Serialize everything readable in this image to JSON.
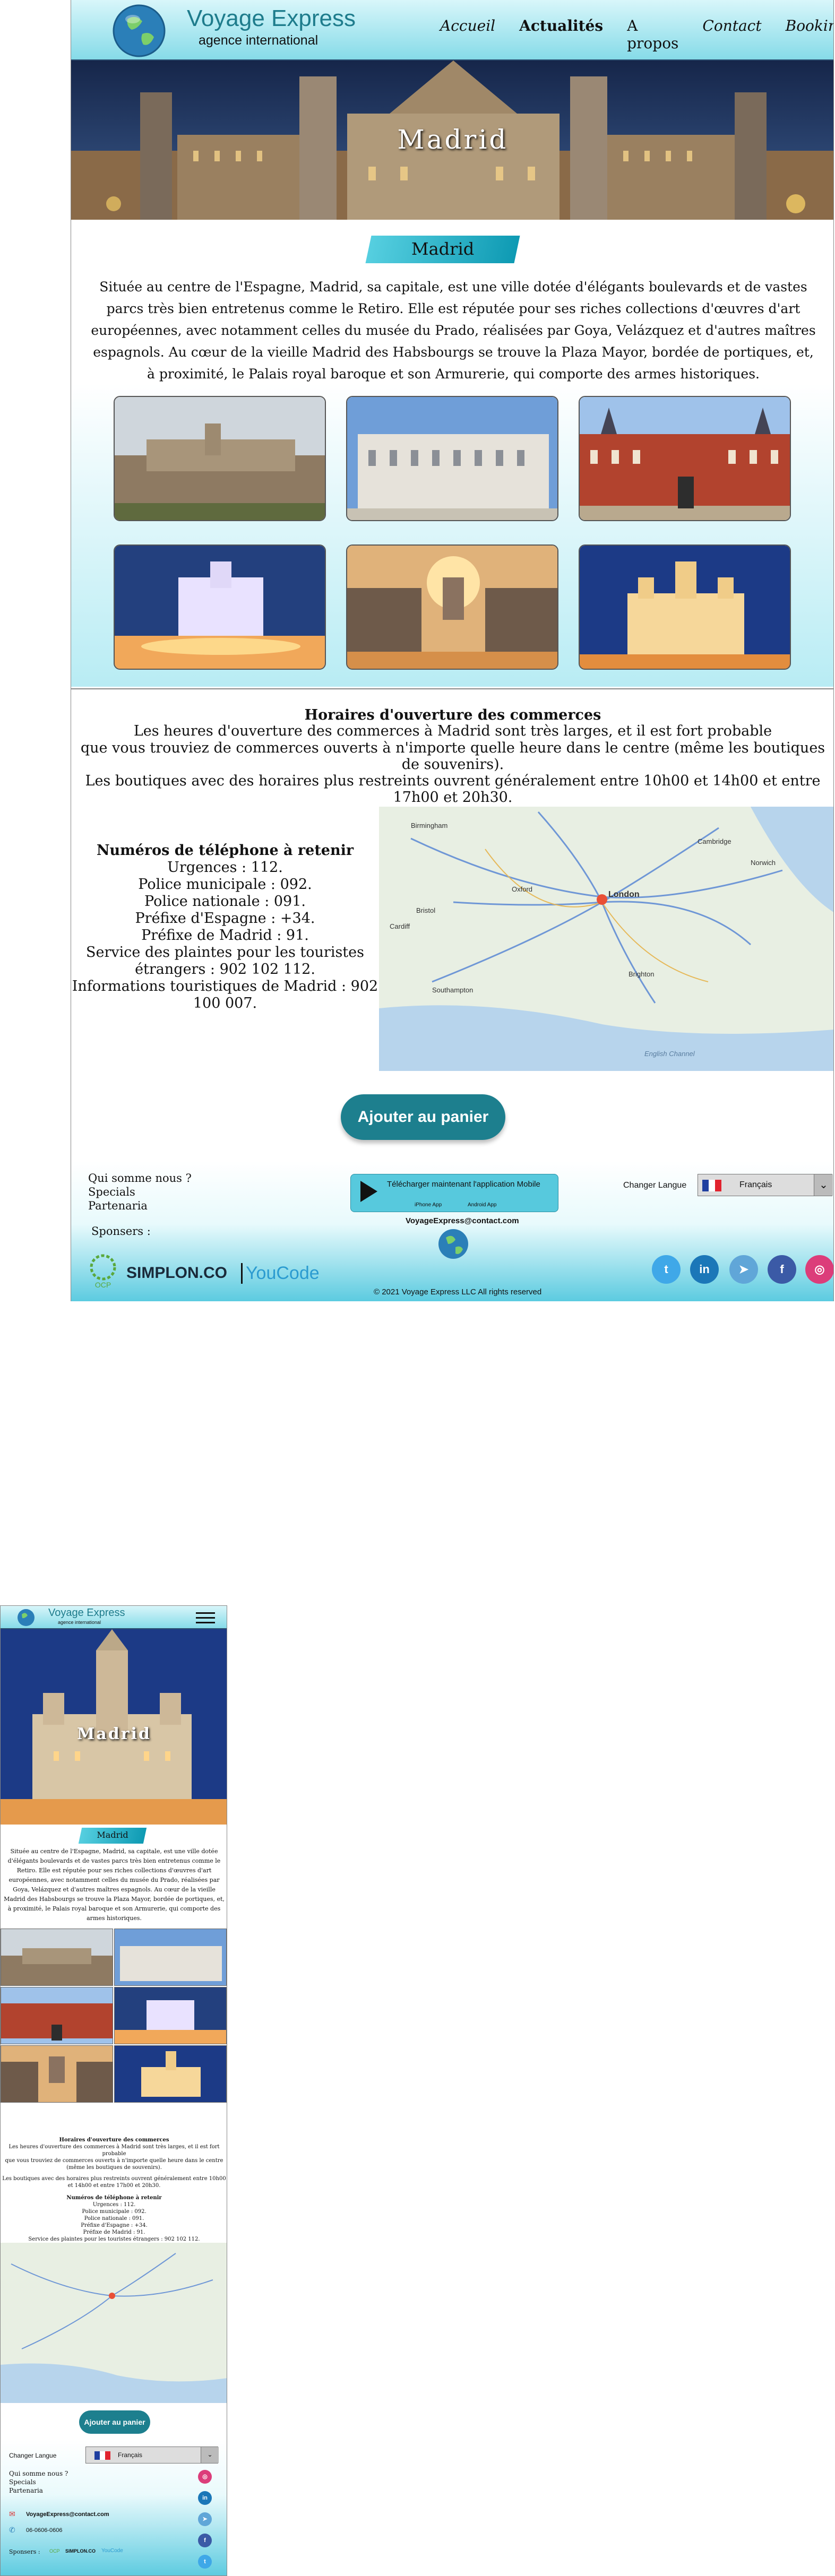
{
  "brand": {
    "name": "Voyage Express",
    "tagline": "agence international"
  },
  "nav": [
    {
      "label": "Accueil"
    },
    {
      "label": "Actualités"
    },
    {
      "label": "A propos"
    },
    {
      "label": "Contact"
    },
    {
      "label": "Booking"
    }
  ],
  "hero": {
    "title": "Madrid"
  },
  "city": {
    "title": "Madrid",
    "intro": "Située au centre de l'Espagne, Madrid, sa capitale, est une ville dotée d'élégants boulevards et de vastes parcs très bien entretenus comme le Retiro. Elle est réputée pour ses riches collections d'œuvres d'art européennes, avec notamment celles du musée du Prado, réalisées par Goya, Velázquez et d'autres maîtres espagnols. Au cœur de la vieille Madrid des Habsbourgs se trouve la Plaza Mayor, bordée de portiques, et, à proximité, le Palais royal baroque et son Armurerie, qui comporte des armes historiques."
  },
  "hours": {
    "title": "Horaires d'ouverture des commerces",
    "line1": "Les heures d'ouverture des commerces à Madrid sont très larges, et il est fort probable",
    "line2": "que vous trouviez de commerces ouverts à n'importe quelle heure dans le centre (même les boutiques de souvenirs).",
    "line3": "Les boutiques avec des horaires plus restreints ouvrent généralement entre 10h00 et 14h00 et entre 17h00 et 20h30."
  },
  "phones": {
    "title": "Numéros de téléphone à retenir",
    "items": [
      "Urgences : 112.",
      "Police municipale : 092.",
      "Police nationale : 091.",
      "Préfixe d'Espagne : +34.",
      "Préfixe de Madrid : 91.",
      "Service des plaintes pour les touristes étrangers : 902 102 112.",
      "Informations touristiques de Madrid : 902 100 007."
    ]
  },
  "map": {
    "labels": [
      "Birmingham",
      "Cambridge",
      "Oxford",
      "London",
      "Southampton",
      "Brighton",
      "Norwich",
      "Bristol",
      "Cardiff",
      "English Channel"
    ]
  },
  "cart": {
    "label": "Ajouter au panier"
  },
  "footer": {
    "links": [
      "Qui somme nous ?",
      "Specials",
      "Partenaria"
    ],
    "sponsors_label": "Sponsers :",
    "sponsors": [
      "OCP",
      "SIMPLON.CO",
      "YouCode"
    ],
    "app_title": "Télécharger maintenant l'application Mobile",
    "app_ios": "iPhone App",
    "app_android": "Android App",
    "email": "VoyageExpress@contact.com",
    "phone": "06-0606-0606",
    "copyright": "© 2021 Voyage Express LLC All rights reserved",
    "lang_label": "Changer Langue",
    "lang_value": "Français",
    "social": [
      "twitter-icon",
      "linkedin-icon",
      "telegram-icon",
      "facebook-icon",
      "instagram-icon"
    ]
  },
  "colors": {
    "primary": "#1d7f8e",
    "header": "#86dbe8",
    "accent": "#0e9ab3"
  }
}
